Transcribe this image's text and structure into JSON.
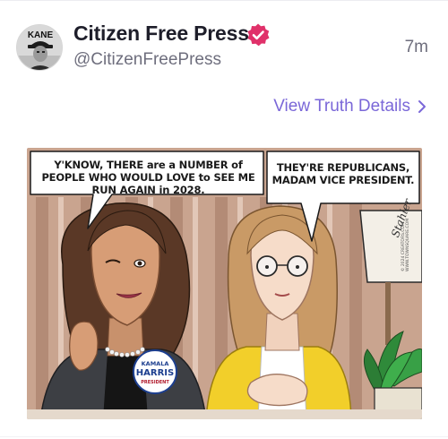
{
  "post": {
    "author": {
      "display_name": "Citizen Free Press",
      "handle": "@CitizenFreePress",
      "avatar_text": "KANE",
      "verified": true,
      "verified_icon": "verified-badge-icon"
    },
    "timestamp": "7m",
    "details_link": {
      "label": "View Truth Details",
      "icon": "chevron-right-icon"
    }
  },
  "cartoon": {
    "bubble_left": "Y'KNOW, THERE are a NUMBER of PEOPLE WHO WOULD LOVE to SEE ME RUN AGAIN in 2028.",
    "bubble_right": "THEY'RE REPUBLICANS, MADAM VICE PRESIDENT.",
    "button_line1": "KAMALA",
    "button_line2": "HARRIS",
    "button_line3": "PRESIDENT",
    "signature": "Stahler",
    "copyright_line1": "© 2024 CREATORS.COM",
    "copyright_line2": "WWW.TOWNSQUARE.COM"
  },
  "colors": {
    "accent": "#7a67d8",
    "verified": "#e0316a",
    "name_text": "#1e1e2a",
    "muted_text": "#6e6e7d"
  }
}
